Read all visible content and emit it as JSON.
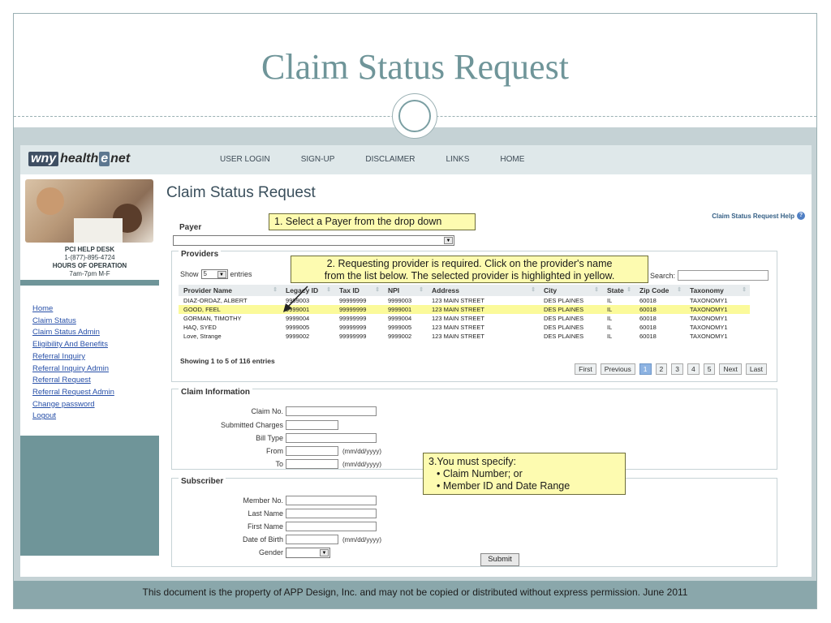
{
  "slide": {
    "title": "Claim Status Request",
    "footer": "This document is the property of APP Design, Inc. and may not be copied or distributed without express permission.  June 2011"
  },
  "app": {
    "logo": {
      "part1": "wny",
      "part2": "health",
      "part3": "e",
      "part4": "net"
    },
    "nav": [
      "USER LOGIN",
      "SIGN-UP",
      "DISCLAIMER",
      "LINKS",
      "HOME"
    ],
    "helpdesk": {
      "line1": "PCI HELP DESK",
      "phone": "1-(877)-895-4724",
      "line3": "HOURS OF OPERATION",
      "hours": "7am-7pm M-F"
    },
    "side_links": [
      "Home",
      "Claim Status",
      "Claim Status Admin",
      "Eligibility And Benefits",
      "Referral Inquiry",
      "Referral Inquiry Admin",
      "Referral Request",
      "Referral Request Admin",
      "Change password",
      "Logout"
    ],
    "page_title": "Claim Status Request",
    "help_link": "Claim Status Request Help",
    "payer_label": "Payer",
    "payer_value": "",
    "providers_label": "Providers",
    "show_label": "Show",
    "show_value": "5",
    "entries_label": "entries",
    "search_label": "Search:",
    "columns": [
      "Provider Name",
      "Legacy ID",
      "Tax ID",
      "NPI",
      "Address",
      "City",
      "State",
      "Zip Code",
      "Taxonomy"
    ],
    "rows": [
      [
        "DIAZ-ORDAZ, ALBERT",
        "9999003",
        "99999999",
        "9999003",
        "123 MAIN STREET",
        "DES PLAINES",
        "IL",
        "60018",
        "TAXONOMY1"
      ],
      [
        "GOOD, FEEL",
        "9999001",
        "99999999",
        "9999001",
        "123 MAIN STREET",
        "DES PLAINES",
        "IL",
        "60018",
        "TAXONOMY1"
      ],
      [
        "GORMAN, TIMOTHY",
        "9999004",
        "99999999",
        "9999004",
        "123 MAIN STREET",
        "DES PLAINES",
        "IL",
        "60018",
        "TAXONOMY1"
      ],
      [
        "HAQ, SYED",
        "9999005",
        "99999999",
        "9999005",
        "123 MAIN STREET",
        "DES PLAINES",
        "IL",
        "60018",
        "TAXONOMY1"
      ],
      [
        "Love, Strange",
        "9999002",
        "99999999",
        "9999002",
        "123 MAIN STREET",
        "DES PLAINES",
        "IL",
        "60018",
        "TAXONOMY1"
      ]
    ],
    "selected_row": 1,
    "showing": "Showing 1 to 5 of 116 entries",
    "pager": [
      "First",
      "Previous",
      "1",
      "2",
      "3",
      "4",
      "5",
      "Next",
      "Last"
    ],
    "pager_active": "1",
    "claim_info": {
      "title": "Claim Information",
      "claim_no": "Claim No.",
      "submitted_charges": "Submitted Charges",
      "bill_type": "Bill Type",
      "from": "From",
      "to": "To",
      "date_hint": "(mm/dd/yyyy)"
    },
    "subscriber": {
      "title": "Subscriber",
      "member_no": "Member No.",
      "last_name": "Last Name",
      "first_name": "First Name",
      "dob": "Date of Birth",
      "gender": "Gender",
      "date_hint": "(mm/dd/yyyy)"
    },
    "submit": "Submit"
  },
  "callouts": {
    "c1": "1. Select a Payer from the drop down",
    "c2_line1": "2. Requesting provider is required. Click on the provider's name",
    "c2_line2": "from the list below.  The selected provider is highlighted in yellow.",
    "c3_line1": "3.You must specify:",
    "c3_b1": "Claim Number; or",
    "c3_b2": "Member ID and Date Range"
  },
  "colors": {
    "accent": "#6f9599",
    "highlight": "#fbfa9a",
    "callout_bg": "#fdfbb0",
    "link": "#2850a8"
  }
}
